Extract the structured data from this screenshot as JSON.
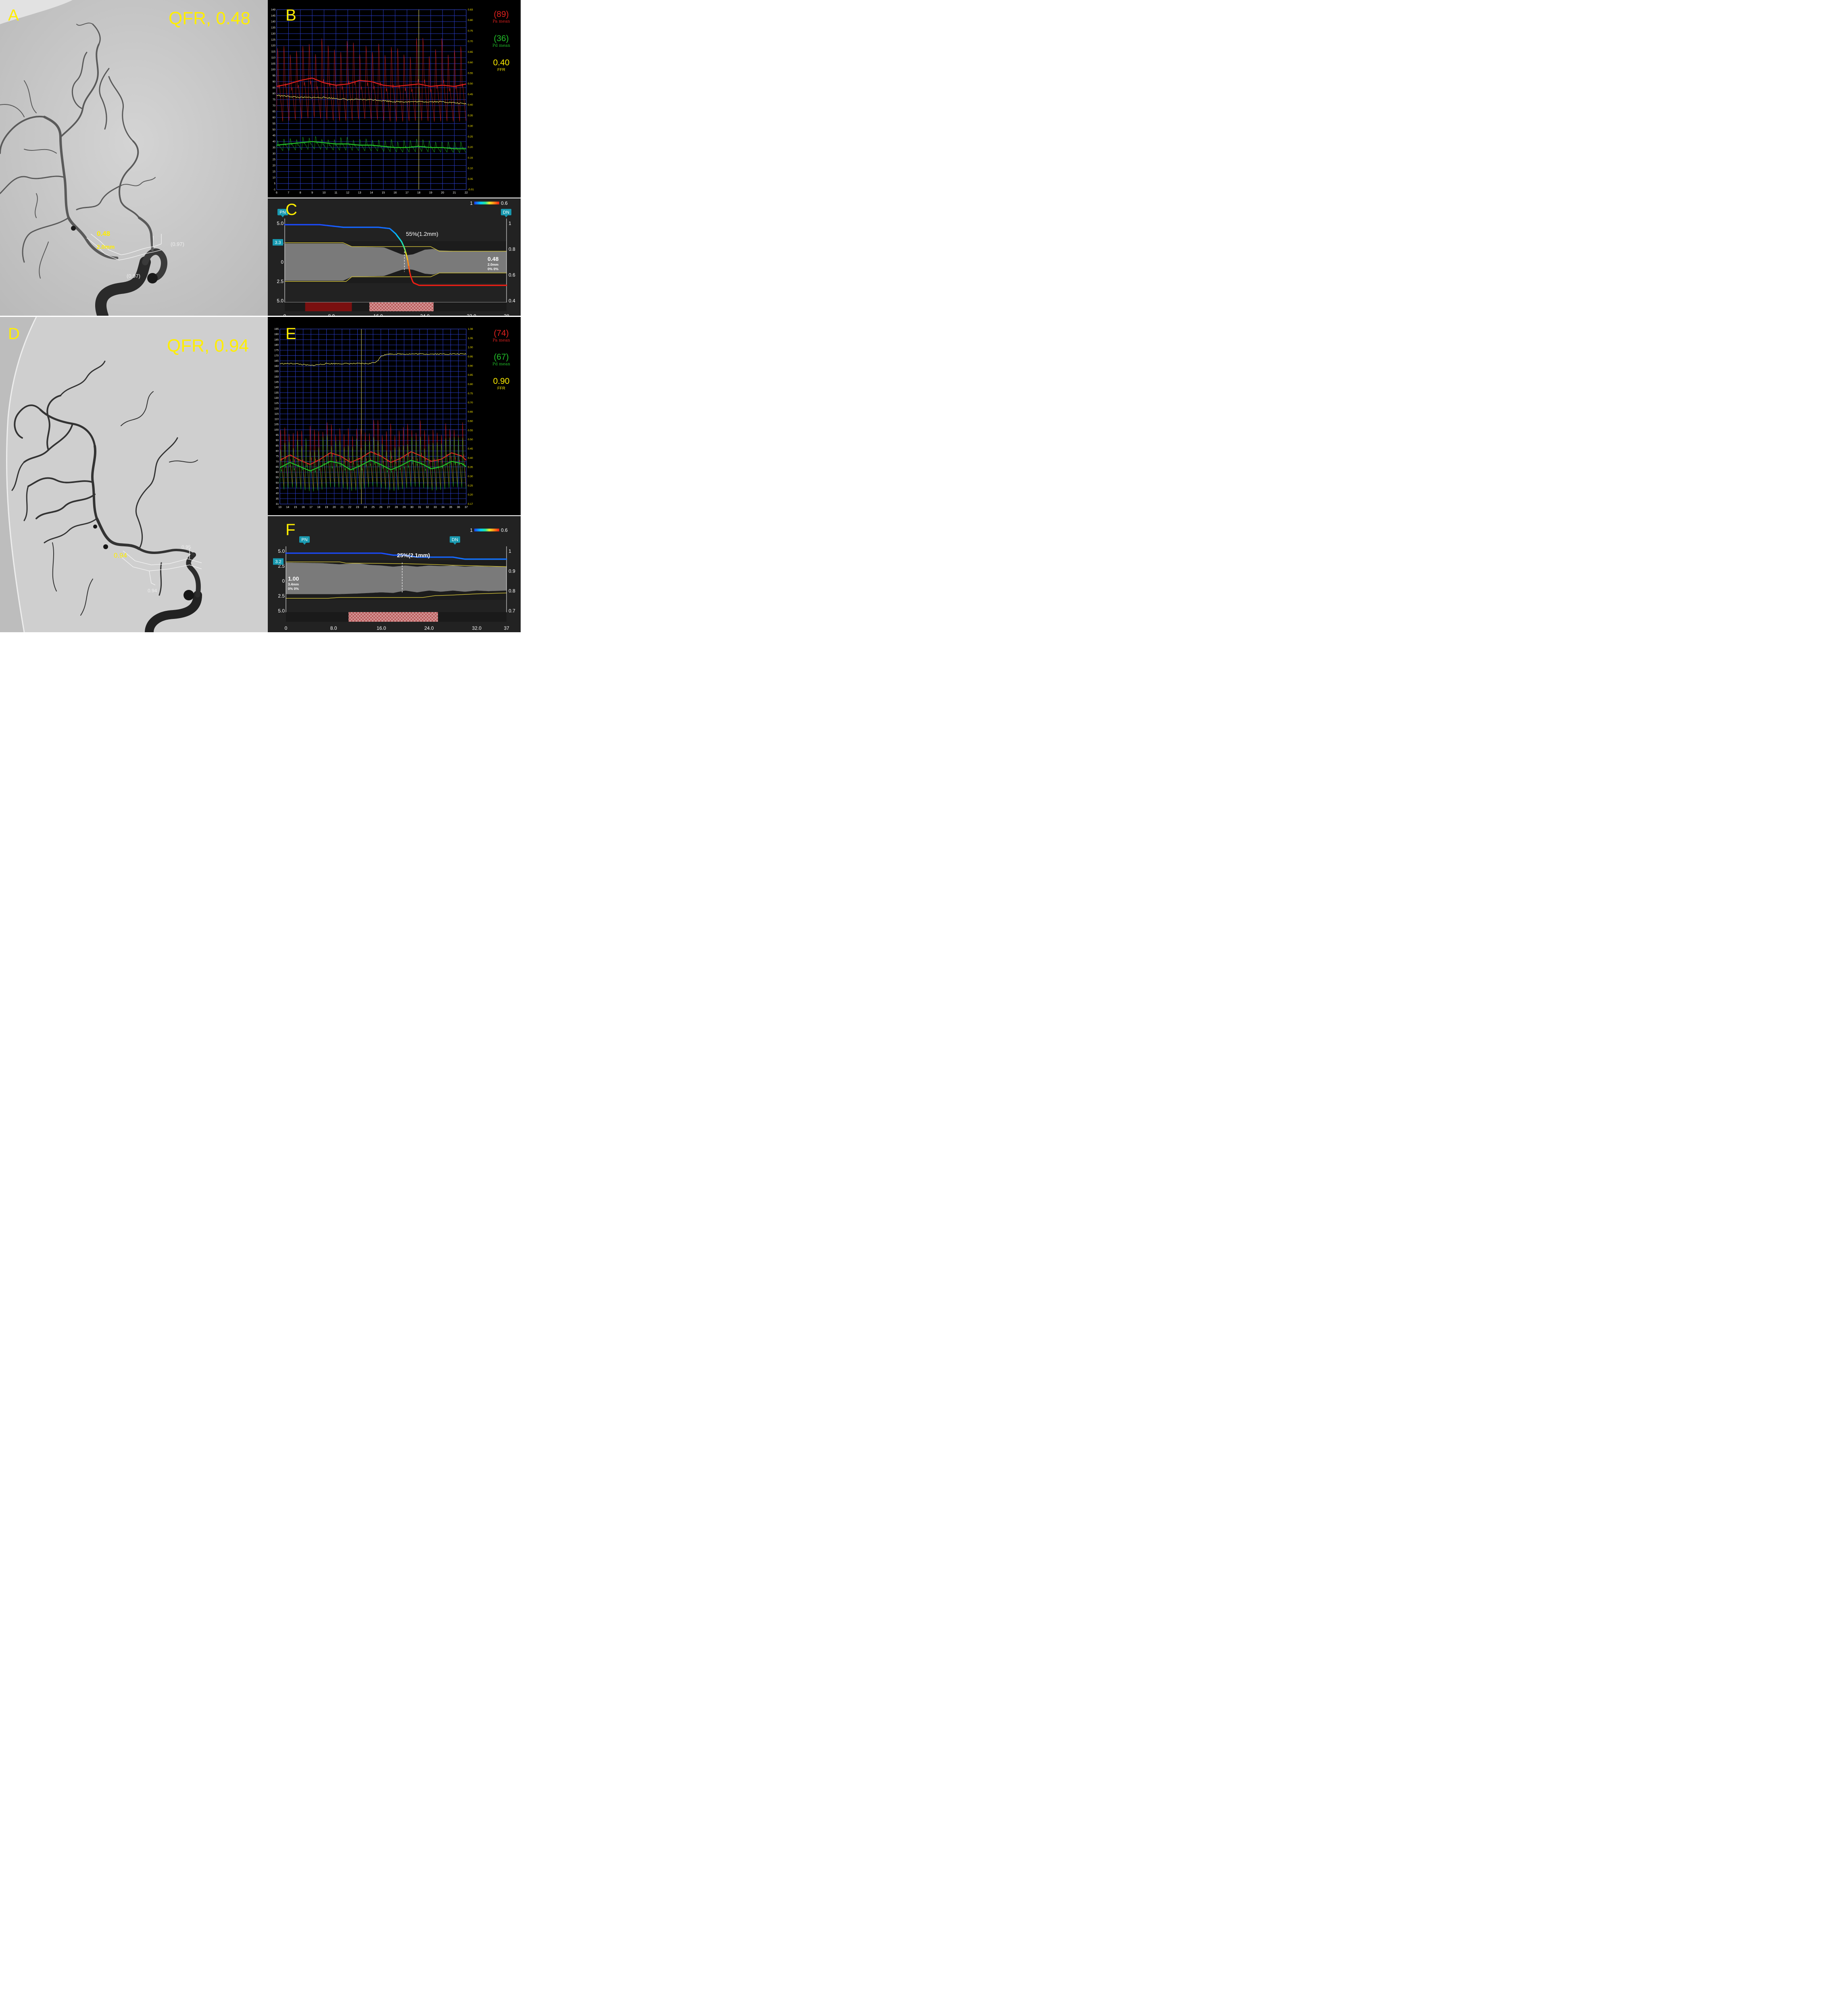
{
  "panels": {
    "A": {
      "label": "A",
      "qfr_text": "QFR, 0.48",
      "vessel_qfr": "0.48",
      "vessel_diam": "2.0mm",
      "side_a": "(0.97)",
      "side_b": "(0.97)"
    },
    "B": {
      "label": "B",
      "pa_value": "(89)",
      "pa_label": "Pa mean",
      "pd_value": "(36)",
      "pd_label": "Pd mean",
      "ffr_value": "0.40",
      "ffr_label": "FFR"
    },
    "C": {
      "label": "C",
      "pn": "PN",
      "dn": "DN",
      "stenosis": "55%(1.2mm)",
      "scale_left": "1",
      "scale_right": "0.6",
      "box_value": "3.3",
      "side_qfr": "0.48",
      "side_diam": "2.0mm",
      "side_pct": "0% 0%"
    },
    "D": {
      "label": "D",
      "qfr_text": "QFR, 0.94",
      "vessel_qfr": "0.94",
      "side_a": "0.95",
      "side_b": "0.94"
    },
    "E": {
      "label": "E",
      "pa_value": "(74)",
      "pa_label": "Pa mean",
      "pd_value": "(67)",
      "pd_label": "Pd mean",
      "ffr_value": "0.90",
      "ffr_label": "FFR"
    },
    "F": {
      "label": "F",
      "pn": "PN",
      "dn": "DN",
      "stenosis": "25%(2.1mm)",
      "scale_left": "1",
      "scale_right": "0.6",
      "box_value": "3.2",
      "side_qfr": "1.00",
      "side_diam": "3.4mm",
      "side_pct": "0% 0%"
    }
  },
  "chart_data": [
    {
      "panel": "B",
      "type": "line",
      "x_ticks": [
        "6",
        "7",
        "8",
        "9",
        "10",
        "11",
        "12",
        "13",
        "14",
        "15",
        "16",
        "17",
        "18",
        "19",
        "20",
        "21",
        "22"
      ],
      "y_left_ticks": [
        "149",
        "145",
        "140",
        "135",
        "130",
        "125",
        "120",
        "115",
        "110",
        "105",
        "100",
        "95",
        "90",
        "85",
        "80",
        "75",
        "70",
        "65",
        "60",
        "55",
        "50",
        "45",
        "40",
        "35",
        "30",
        "25",
        "20",
        "15",
        "10",
        "5",
        "-1"
      ],
      "y_right_ticks": [
        "0.83",
        "0.80",
        "0.75",
        "0.70",
        "0.65",
        "0.60",
        "0.55",
        "0.50",
        "0.45",
        "0.40",
        "0.35",
        "0.30",
        "0.25",
        "0.20",
        "0.15",
        "0.10",
        "0.05",
        "-0.01"
      ],
      "xlim": [
        6,
        22
      ],
      "ylim_left": [
        -1,
        149
      ],
      "ylim_right": [
        -0.01,
        0.83
      ],
      "cursor_x": 18,
      "series": [
        {
          "name": "Pa",
          "color": "#e0201e",
          "pulse_min": 61,
          "pulse_max": 131,
          "beats": 30,
          "mean_x": [
            6,
            7,
            8,
            9,
            10,
            11,
            12,
            13,
            14,
            15,
            16,
            17,
            18,
            19,
            20,
            21,
            22
          ],
          "mean": [
            85,
            87,
            90,
            92,
            88,
            86,
            87,
            90,
            89,
            86,
            85,
            86,
            87,
            85,
            86,
            85,
            87
          ]
        },
        {
          "name": "Pd",
          "color": "#22c02a",
          "pulse_min": 32,
          "pulse_max": 43,
          "beats": 30,
          "mean_x": [
            6,
            7,
            8,
            9,
            10,
            11,
            12,
            13,
            14,
            15,
            16,
            17,
            18,
            19,
            20,
            21,
            22
          ],
          "mean": [
            36,
            37,
            38,
            39,
            38,
            37,
            37,
            36,
            36,
            35,
            34,
            34,
            35,
            34,
            34,
            33,
            33
          ]
        },
        {
          "name": "FFR",
          "color": "#f4ef6a",
          "axis": "right",
          "x": [
            6,
            8,
            10,
            12,
            14,
            16,
            18,
            20,
            22
          ],
          "values": [
            0.43,
            0.42,
            0.42,
            0.41,
            0.41,
            0.4,
            0.4,
            0.4,
            0.39
          ]
        }
      ]
    },
    {
      "panel": "E",
      "type": "line",
      "x_ticks": [
        "13",
        "14",
        "15",
        "16",
        "17",
        "18",
        "19",
        "20",
        "21",
        "22",
        "23",
        "24",
        "25",
        "26",
        "27",
        "28",
        "29",
        "30",
        "31",
        "32",
        "33",
        "34",
        "35",
        "36",
        "37"
      ],
      "y_left_ticks": [
        "195",
        "190",
        "185",
        "180",
        "175",
        "170",
        "165",
        "160",
        "155",
        "150",
        "145",
        "140",
        "135",
        "130",
        "125",
        "120",
        "115",
        "110",
        "105",
        "100",
        "95",
        "90",
        "85",
        "80",
        "75",
        "70",
        "65",
        "60",
        "55",
        "50",
        "45",
        "40",
        "35",
        "31"
      ],
      "y_right_ticks": [
        "1.08",
        "1.05",
        "1.00",
        "0.95",
        "0.90",
        "0.85",
        "0.80",
        "0.75",
        "0.70",
        "0.65",
        "0.60",
        "0.55",
        "0.50",
        "0.45",
        "0.40",
        "0.35",
        "0.30",
        "0.25",
        "0.20",
        "0.17"
      ],
      "xlim": [
        13,
        37
      ],
      "ylim_left": [
        31,
        195
      ],
      "ylim_right": [
        0.17,
        1.08
      ],
      "cursor_x": 23.5,
      "series": [
        {
          "name": "Pa",
          "color": "#e0201e",
          "pulse_min": 52,
          "pulse_max": 113,
          "beats": 44,
          "mean_x": [
            13,
            14.3,
            15.6,
            16.9,
            18.2,
            19.5,
            20.8,
            22.1,
            23.4,
            24.7,
            26.0,
            27.3,
            28.6,
            29.9,
            31.2,
            32.5,
            33.8,
            35.1,
            36.4,
            37
          ],
          "mean": [
            72,
            77,
            72,
            68,
            73,
            79,
            76,
            70,
            74,
            80,
            76,
            70,
            74,
            80,
            76,
            71,
            73,
            79,
            76,
            72
          ]
        },
        {
          "name": "Pd",
          "color": "#22c02a",
          "pulse_min": 48,
          "pulse_max": 98,
          "beats": 44,
          "mean_x": [
            13,
            14.3,
            15.6,
            16.9,
            18.2,
            19.5,
            20.8,
            22.1,
            23.4,
            24.7,
            26.0,
            27.3,
            28.6,
            29.9,
            31.2,
            32.5,
            33.8,
            35.1,
            36.4,
            37
          ],
          "mean": [
            65,
            70,
            66,
            62,
            66,
            71,
            69,
            63,
            67,
            72,
            68,
            63,
            67,
            72,
            69,
            64,
            66,
            71,
            69,
            66
          ]
        },
        {
          "name": "FFR",
          "color": "#f4ef6a",
          "axis": "right",
          "x": [
            13,
            15,
            17,
            19,
            21,
            23,
            24.5,
            25.5,
            26,
            27,
            29,
            31,
            33,
            35,
            37
          ],
          "values": [
            0.9,
            0.9,
            0.89,
            0.9,
            0.9,
            0.9,
            0.9,
            0.91,
            0.94,
            0.95,
            0.95,
            0.95,
            0.95,
            0.95,
            0.95
          ]
        }
      ]
    },
    {
      "panel": "C",
      "type": "area",
      "x_ticks": [
        "0",
        "8.0",
        "16.0",
        "24.0",
        "32.0",
        "38"
      ],
      "y_left_ticks": [
        "5.0",
        "2.5",
        "0",
        "2.5",
        "5.0"
      ],
      "y_right_ticks": [
        "1",
        "0.8",
        "0.6",
        "0.4"
      ],
      "xlim": [
        0,
        38
      ],
      "ylim_diam": [
        -5,
        5
      ],
      "ylim_qfr": [
        0.4,
        1.0
      ],
      "stenosis_x": 20.5,
      "qfr_x": [
        0,
        6,
        8,
        10,
        12,
        14,
        16,
        18,
        19,
        20,
        20.5,
        21,
        21.5,
        22,
        23,
        26,
        30,
        38
      ],
      "qfr": [
        0.99,
        0.99,
        0.98,
        0.97,
        0.97,
        0.97,
        0.97,
        0.96,
        0.92,
        0.86,
        0.81,
        0.73,
        0.6,
        0.54,
        0.52,
        0.52,
        0.52,
        0.52
      ],
      "upper_x": [
        0,
        10,
        11.5,
        17,
        20,
        21,
        22,
        24,
        25.5,
        26.5,
        30,
        38
      ],
      "upper": [
        2.4,
        2.4,
        2.0,
        1.9,
        1.0,
        0.9,
        1.0,
        1.6,
        1.7,
        1.5,
        1.4,
        1.4
      ],
      "lower_x": [
        0,
        10,
        11.5,
        17,
        20,
        21,
        22,
        24,
        25.5,
        26.5,
        30,
        38
      ],
      "lower": [
        -2.4,
        -2.4,
        -1.9,
        -1.8,
        -1.0,
        -0.9,
        -1.0,
        -1.5,
        -1.6,
        -1.4,
        -1.4,
        -1.4
      ],
      "ref_upper_x": [
        0,
        10,
        11.5,
        25,
        26.5,
        38
      ],
      "ref_upper": [
        2.5,
        2.5,
        2.0,
        2.0,
        1.4,
        1.4
      ],
      "ref_lower_x": [
        0,
        10.5,
        11.5,
        25,
        26.5,
        38
      ],
      "ref_lower": [
        -2.5,
        -2.5,
        -1.9,
        -1.9,
        -1.4,
        -1.4
      ],
      "bar_segments": [
        {
          "x0": 3.5,
          "x1": 11.5,
          "style": "solid"
        },
        {
          "x0": 14.5,
          "x1": 25.5,
          "style": "hatched"
        }
      ]
    },
    {
      "panel": "F",
      "type": "area",
      "x_ticks": [
        "0",
        "8.0",
        "16.0",
        "24.0",
        "32.0",
        "37"
      ],
      "y_left_ticks": [
        "5.0",
        "2.5",
        "0",
        "2.5",
        "5.0"
      ],
      "y_right_ticks": [
        "1",
        "0.9",
        "0.8",
        "0.7"
      ],
      "xlim": [
        0,
        37
      ],
      "ylim_diam": [
        -5,
        5
      ],
      "ylim_qfr": [
        0.7,
        1.0
      ],
      "stenosis_x": 19.5,
      "qfr_x": [
        0,
        3,
        8,
        12,
        16,
        18,
        20,
        22,
        24,
        26,
        28,
        30,
        33,
        37
      ],
      "qfr": [
        0.99,
        0.99,
        0.99,
        0.99,
        0.99,
        0.98,
        0.98,
        0.97,
        0.97,
        0.97,
        0.97,
        0.96,
        0.96,
        0.96
      ],
      "upper_x": [
        0,
        6,
        9,
        12,
        14,
        16,
        18,
        20,
        22,
        24,
        26,
        28,
        30,
        32,
        34,
        37
      ],
      "upper": [
        3.1,
        3.0,
        2.8,
        3.0,
        2.7,
        2.6,
        2.4,
        2.6,
        2.4,
        2.6,
        2.5,
        2.6,
        2.4,
        2.5,
        2.4,
        2.4
      ],
      "lower_x": [
        0,
        6,
        9,
        12,
        14,
        16,
        18,
        20,
        22,
        24,
        26,
        28,
        30,
        32,
        34,
        37
      ],
      "lower": [
        -2.2,
        -2.2,
        -2.2,
        -2.1,
        -2.0,
        -1.9,
        -2.0,
        -1.6,
        -1.9,
        -1.6,
        -1.8,
        -1.6,
        -1.8,
        -1.6,
        -1.7,
        -1.6
      ],
      "ref_upper_x": [
        0,
        9,
        10,
        16,
        20,
        24,
        28,
        32,
        37
      ],
      "ref_upper": [
        3.2,
        3.2,
        3.0,
        2.95,
        2.9,
        2.8,
        2.65,
        2.55,
        2.4
      ],
      "ref_lower_x": [
        0,
        7,
        9,
        16,
        23,
        25,
        28,
        32,
        37
      ],
      "ref_lower": [
        -2.9,
        -2.9,
        -2.75,
        -2.75,
        -2.75,
        -2.45,
        -2.35,
        -2.15,
        -2.0
      ],
      "bar_segments": [
        {
          "x0": 10.5,
          "x1": 25.5,
          "style": "hatched"
        }
      ]
    }
  ]
}
